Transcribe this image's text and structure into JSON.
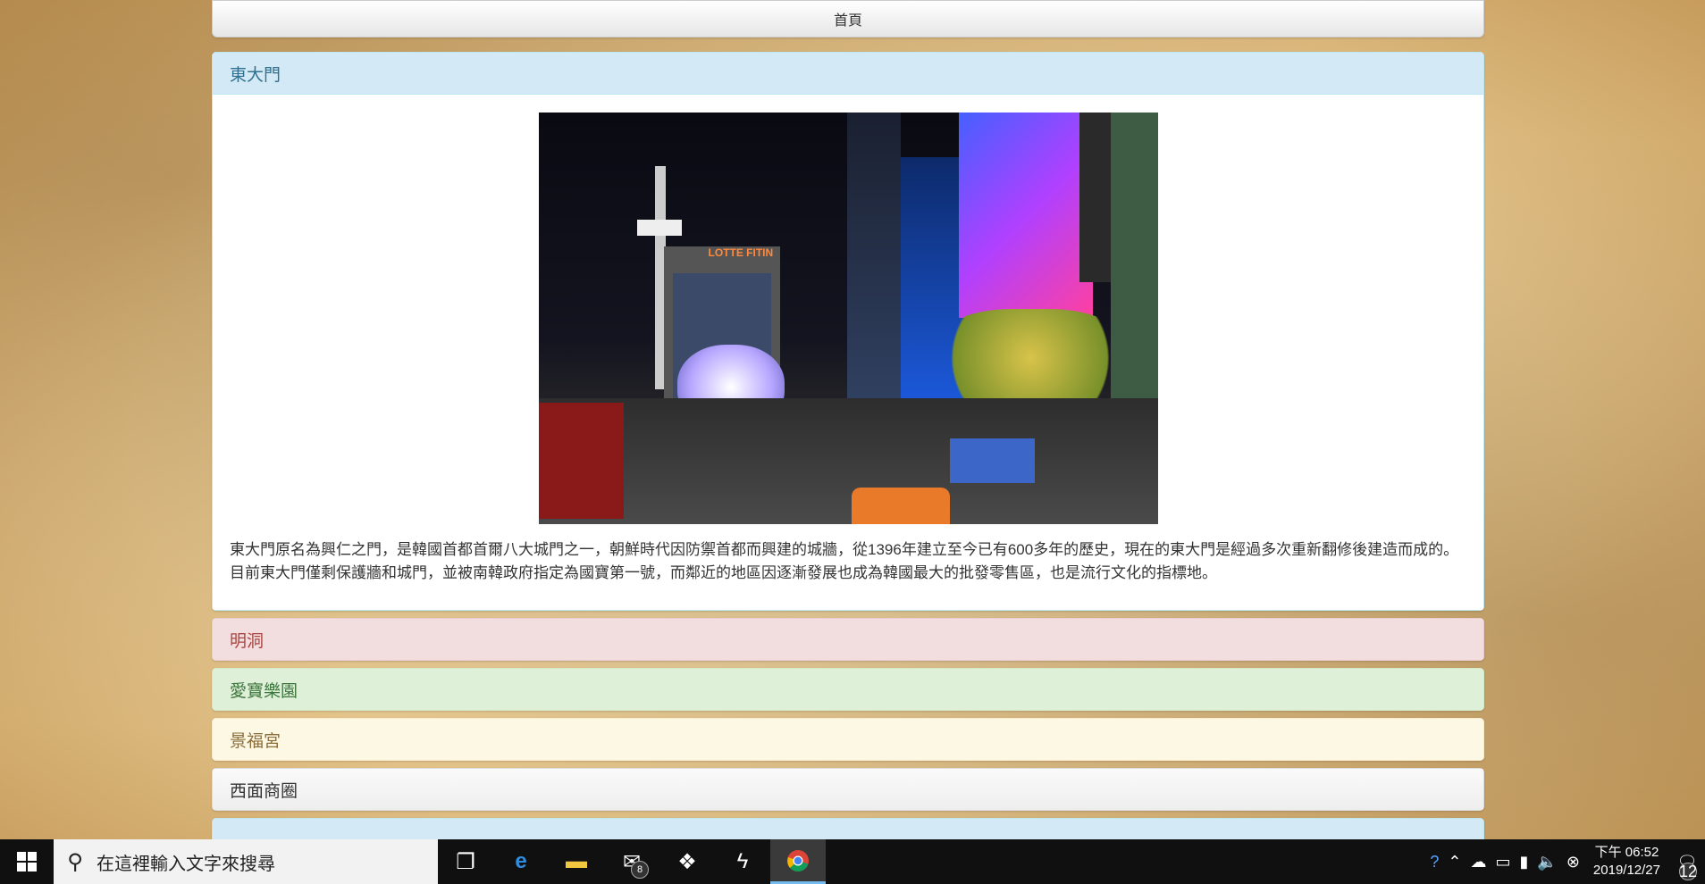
{
  "nav": {
    "home_label": "首頁"
  },
  "panels": [
    {
      "title": "東大門",
      "style": "info",
      "expanded": true,
      "image_alt": "東大門夜景",
      "photo_sign": "LOTTE FITIN",
      "description": "東大門原名為興仁之門，是韓國首都首爾八大城門之一，朝鮮時代因防禦首都而興建的城牆，從1396年建立至今已有600多年的歷史，現在的東大門是經過多次重新翻修後建造而成的。目前東大門僅剩保護牆和城門，並被南韓政府指定為國寶第一號，而鄰近的地區因逐漸發展也成為韓國最大的批發零售區，也是流行文化的指標地。"
    },
    {
      "title": "明洞",
      "style": "danger"
    },
    {
      "title": "愛寶樂園",
      "style": "success"
    },
    {
      "title": "景福宮",
      "style": "warning"
    },
    {
      "title": "西面商圈",
      "style": "default"
    }
  ],
  "taskbar": {
    "search_placeholder": "在這裡輸入文字來搜尋",
    "mail_badge": "8",
    "clock_time": "下午 06:52",
    "clock_date": "2019/12/27",
    "notification_count": "12"
  },
  "colors": {
    "accent": "#76b9ed",
    "info_header": "#d3e9f5"
  }
}
